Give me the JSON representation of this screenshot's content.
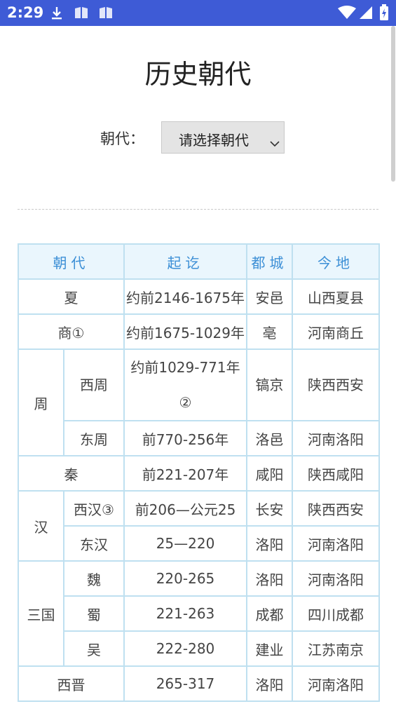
{
  "status_bar": {
    "time": "2:29",
    "icons": [
      "download-icon",
      "book-icon",
      "book-icon",
      "wifi-icon",
      "signal-icon",
      "battery-charging-icon"
    ]
  },
  "page": {
    "title": "历史朝代",
    "picker_label": "朝代：",
    "picker_value": "请选择朝代"
  },
  "table": {
    "headers": {
      "dynasty": "朝代",
      "period": "起讫",
      "capital": "都城",
      "location": "今地"
    },
    "xia": {
      "name": "夏",
      "period": "约前2146-1675年",
      "capital": "安邑",
      "location": "山西夏县"
    },
    "shang": {
      "name": "商①",
      "period": "约前1675-1029年",
      "capital": "亳",
      "location": "河南商丘"
    },
    "zhou": {
      "name": "周",
      "west": {
        "name": "西周",
        "period": "约前1029-771年②",
        "capital": "镐京",
        "location": "陕西西安"
      },
      "east": {
        "name": "东周",
        "period": "前770-256年",
        "capital": "洛邑",
        "location": "河南洛阳"
      }
    },
    "qin": {
      "name": "秦",
      "period": "前221-207年",
      "capital": "咸阳",
      "location": "陕西咸阳"
    },
    "han": {
      "name": "汉",
      "west": {
        "name": "西汉③",
        "period": "前206—公元25",
        "capital": "长安",
        "location": "陕西西安"
      },
      "east": {
        "name": "东汉",
        "period": "25—220",
        "capital": "洛阳",
        "location": "河南洛阳"
      }
    },
    "three_kingdoms": {
      "name": "三国",
      "wei": {
        "name": "魏",
        "period": "220-265",
        "capital": "洛阳",
        "location": "河南洛阳"
      },
      "shu": {
        "name": "蜀",
        "period": "221-263",
        "capital": "成都",
        "location": "四川成都"
      },
      "wu": {
        "name": "吴",
        "period": "222-280",
        "capital": "建业",
        "location": "江苏南京"
      }
    },
    "western_jin": {
      "name": "西晋",
      "period": "265-317",
      "capital": "洛阳",
      "location": "河南洛阳"
    }
  }
}
